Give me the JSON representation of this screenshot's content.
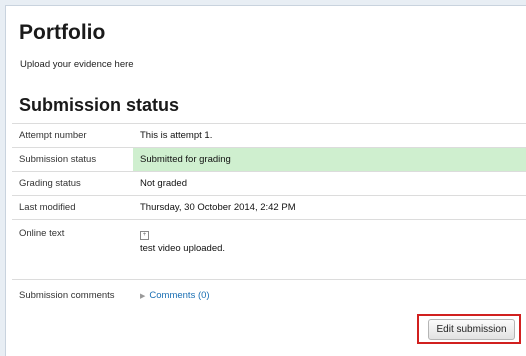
{
  "page": {
    "title": "Portfolio",
    "intro": "Upload your evidence here",
    "section_title": "Submission status"
  },
  "status_table": {
    "attempt": {
      "label": "Attempt number",
      "value": "This is attempt 1."
    },
    "submission": {
      "label": "Submission status",
      "value": "Submitted for grading",
      "color": "#cfefcf"
    },
    "grading": {
      "label": "Grading status",
      "value": "Not graded"
    },
    "modified": {
      "label": "Last modified",
      "value": "Thursday, 30 October 2014, 2:42 PM"
    },
    "online_text": {
      "label": "Online text",
      "icon": "expand-icon",
      "value": "test video uploaded."
    },
    "comments": {
      "label": "Submission comments",
      "link": "Comments (0)"
    }
  },
  "actions": {
    "edit_submission": "Edit submission",
    "highlight_color": "#d1201f"
  }
}
